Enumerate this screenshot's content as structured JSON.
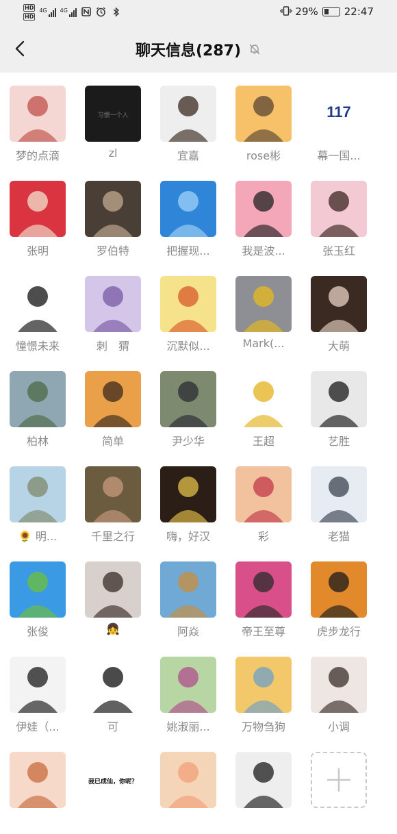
{
  "status_bar": {
    "hd1": "HD",
    "hd2": "HD",
    "net1": "4G",
    "net2": "4G",
    "battery_percent": "29%",
    "time": "22:47",
    "icons": [
      "nfc-icon",
      "alarm-icon",
      "bluetooth-icon",
      "vibrate-icon",
      "battery-icon"
    ]
  },
  "header": {
    "title": "聊天信息(287)",
    "back_icon": "chevron-left-icon",
    "mute_icon": "bell-off-icon"
  },
  "members": [
    {
      "name": "梦的点滴",
      "avatar": [
        "#f4d6d2",
        "#c0504a"
      ]
    },
    {
      "name": "zl",
      "avatar": [
        "#1b1b1b",
        "#555555"
      ],
      "avatar_text": "习惯一个人"
    },
    {
      "name": "宜嘉",
      "avatar": [
        "#eeeeee",
        "#3a2a20"
      ]
    },
    {
      "name": "rose彬",
      "avatar": [
        "#f7c16a",
        "#5b4533"
      ]
    },
    {
      "name": "幕一国...",
      "avatar": [
        "#ffffff",
        "#1f3b8a"
      ],
      "avatar_text": "117"
    },
    {
      "name": "张明",
      "avatar": [
        "#d9343f",
        "#f1e2d0"
      ]
    },
    {
      "name": "罗伯特",
      "avatar": [
        "#4a3f37",
        "#c2aa92"
      ]
    },
    {
      "name": "把握现...",
      "avatar": [
        "#2f86d9",
        "#9fd0f5"
      ]
    },
    {
      "name": "我是波...",
      "avatar": [
        "#f4a7b9",
        "#222222"
      ]
    },
    {
      "name": "张玉红",
      "avatar": [
        "#f3c9d4",
        "#3b2620"
      ]
    },
    {
      "name": "憧憬未来",
      "avatar": [
        "#ffffff",
        "#111111"
      ]
    },
    {
      "name": "刺　猬",
      "avatar": [
        "#d4c6e8",
        "#7a5aa6"
      ]
    },
    {
      "name": "沉默似...",
      "avatar": [
        "#f6e28a",
        "#d85a2b"
      ]
    },
    {
      "name": "Mark(...",
      "avatar": [
        "#8d8f94",
        "#e9b91c"
      ]
    },
    {
      "name": "大萌",
      "avatar": [
        "#3b2a22",
        "#e8d2c3"
      ]
    },
    {
      "name": "柏林",
      "avatar": [
        "#8fa6b3",
        "#4d6a45"
      ]
    },
    {
      "name": "简单",
      "avatar": [
        "#e9a049",
        "#3b2a1c"
      ]
    },
    {
      "name": "尹少华",
      "avatar": [
        "#7d8a6f",
        "#2b2b33"
      ]
    },
    {
      "name": "王超",
      "avatar": [
        "#ffffff",
        "#e3b11c"
      ]
    },
    {
      "name": "艺胜",
      "avatar": [
        "#e8e8e8",
        "#1a1a1a"
      ]
    },
    {
      "name": "🌻 明...",
      "avatar": [
        "#b7d4e6",
        "#7f8a6b"
      ]
    },
    {
      "name": "千里之行",
      "avatar": [
        "#6b5b3f",
        "#c79a7d"
      ]
    },
    {
      "name": "嗨，好汉",
      "avatar": [
        "#2b1e16",
        "#e3c04a"
      ]
    },
    {
      "name": "彩",
      "avatar": [
        "#f2c19e",
        "#c23a4a"
      ]
    },
    {
      "name": "老猫",
      "avatar": [
        "#e6ecf2",
        "#3c4450"
      ]
    },
    {
      "name": "张俊",
      "avatar": [
        "#3a9be4",
        "#6fbf3a"
      ]
    },
    {
      "name": "👧",
      "avatar": [
        "#d8d0cc",
        "#3a2c28"
      ]
    },
    {
      "name": "阿焱",
      "avatar": [
        "#6fa9d4",
        "#c98f3d"
      ]
    },
    {
      "name": "帝王至尊",
      "avatar": [
        "#d94f8a",
        "#2a2a2a"
      ]
    },
    {
      "name": "虎步龙行",
      "avatar": [
        "#e2892c",
        "#1b1b1b"
      ]
    },
    {
      "name": "伊娃（...",
      "avatar": [
        "#f3f3f3",
        "#1a1a1a"
      ]
    },
    {
      "name": "可",
      "avatar": [
        "#ffffff",
        "#0d0d0d"
      ]
    },
    {
      "name": "姚淑丽...",
      "avatar": [
        "#b7d6a4",
        "#b04f8c"
      ]
    },
    {
      "name": "万物刍狗",
      "avatar": [
        "#f2c86a",
        "#6fa0c8"
      ]
    },
    {
      "name": "小调",
      "avatar": [
        "#ede6e2",
        "#3a2e2a"
      ]
    },
    {
      "name": "",
      "avatar": [
        "#f6d9c8",
        "#c86a3f"
      ]
    },
    {
      "name": "",
      "avatar": [
        "#ffffff",
        "#111111"
      ],
      "avatar_text": "我已成仙，你呢？"
    },
    {
      "name": "",
      "avatar": [
        "#f4d5b8",
        "#f3a07a"
      ]
    },
    {
      "name": "",
      "avatar": [
        "#eeeeee",
        "#1b1b1b"
      ]
    }
  ],
  "add_member": {
    "icon": "plus-icon"
  }
}
